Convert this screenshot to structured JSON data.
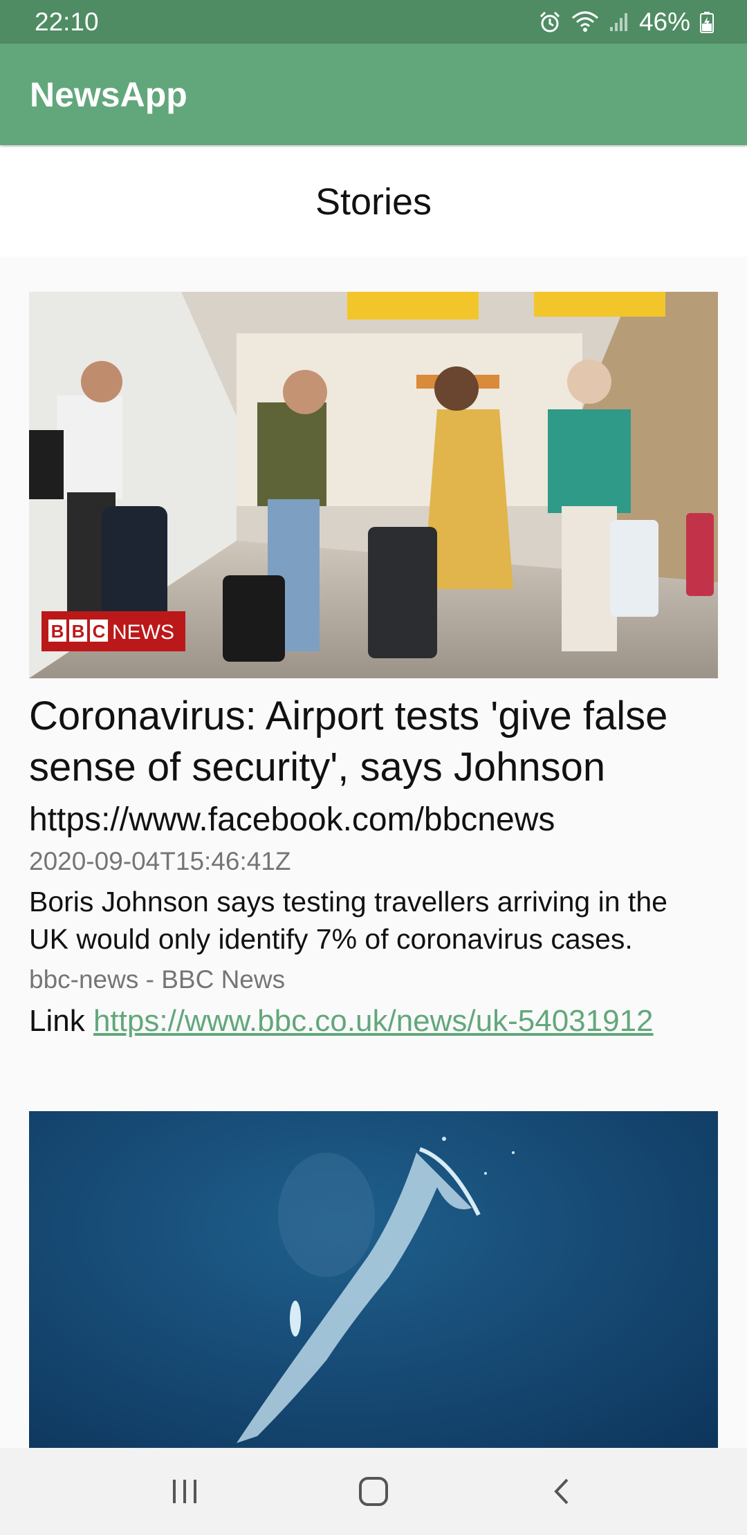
{
  "status_bar": {
    "time": "22:10",
    "battery": "46%",
    "icons": [
      "alarm-icon",
      "wifi-icon",
      "signal-icon",
      "battery-charging-icon"
    ]
  },
  "app_bar": {
    "title": "NewsApp"
  },
  "section": {
    "title": "Stories"
  },
  "stories": [
    {
      "image_desc": "travellers-wearing-masks-in-airport",
      "image_badge": "BBC NEWS",
      "headline": "Coronavirus: Airport tests 'give false sense of security', says Johnson",
      "source_url": "https://www.facebook.com/bbcnews",
      "published_at": "2020-09-04T15:46:41Z",
      "description": "Boris Johnson says testing travellers arriving in the UK would only identify 7% of coronavirus cases.",
      "source_name": "bbc-news - BBC News",
      "link_label": "Link ",
      "link_url": "https://www.bbc.co.uk/news/uk-54031912"
    },
    {
      "image_desc": "whale-in-deep-blue-ocean"
    }
  ],
  "nav_bar": {
    "icons": [
      "recent-apps-icon",
      "home-icon",
      "back-icon"
    ]
  },
  "colors": {
    "status_bar": "#4f8c64",
    "app_bar": "#62a77b",
    "link": "#62a77b"
  }
}
